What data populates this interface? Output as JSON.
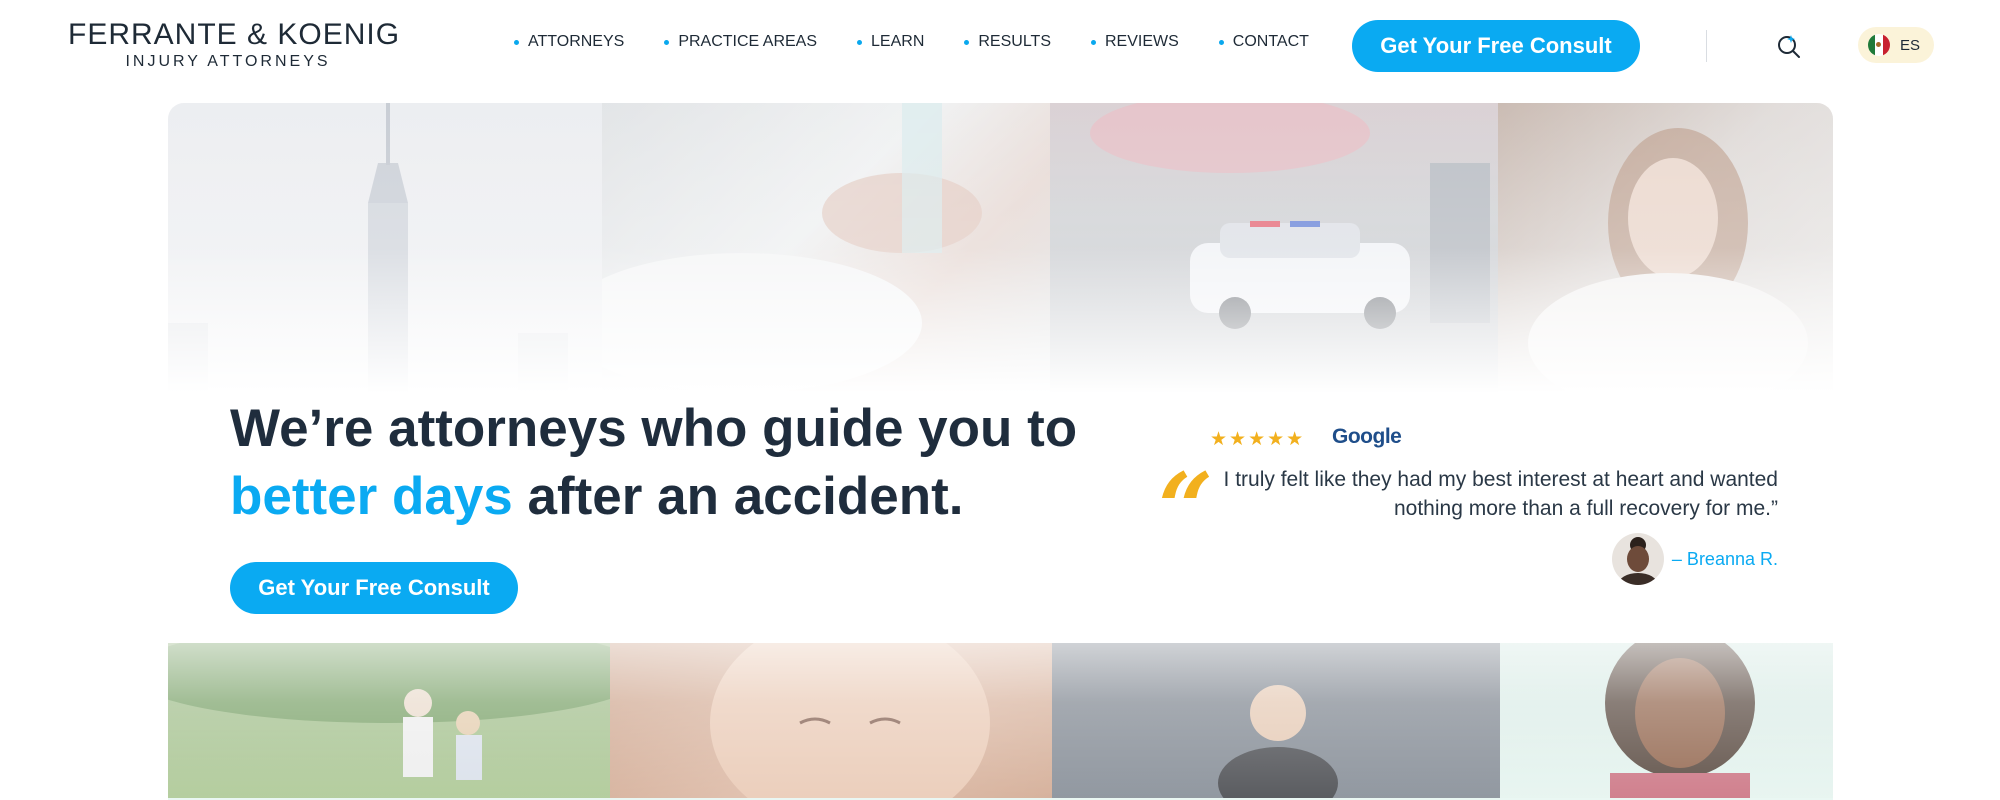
{
  "header": {
    "logo": {
      "line1": "FERRANTE & KOENIG",
      "line2": "INJURY ATTORNEYS"
    },
    "nav": [
      {
        "label": "ATTORNEYS"
      },
      {
        "label": "PRACTICE AREAS"
      },
      {
        "label": "LEARN"
      },
      {
        "label": "RESULTS"
      },
      {
        "label": "REVIEWS"
      },
      {
        "label": "CONTACT"
      }
    ],
    "cta_label": "Get Your Free Consult",
    "search_icon": "search-icon",
    "language": {
      "label": "ES",
      "flag": "mexico-flag-icon"
    }
  },
  "hero": {
    "headline": {
      "p1": "We’re ",
      "b1": "attorneys",
      "p2": " who guide you to",
      "blue": "better days",
      "p3": " after an ",
      "b2": "accident",
      "p4": "."
    },
    "cta_label": "Get Your Free Consult",
    "review": {
      "stars": "★★★★★",
      "rating": 5,
      "source": "Google",
      "quote_mark": "“",
      "text": "I truly felt like they had my best interest at heart and wanted nothing more than a full recovery for me.”",
      "author": "– Breanna R."
    }
  },
  "colors": {
    "accent": "#0aaaf2",
    "star": "#f2b01e",
    "text": "#1f2d3d",
    "lang_bg": "#fbf3d9"
  }
}
